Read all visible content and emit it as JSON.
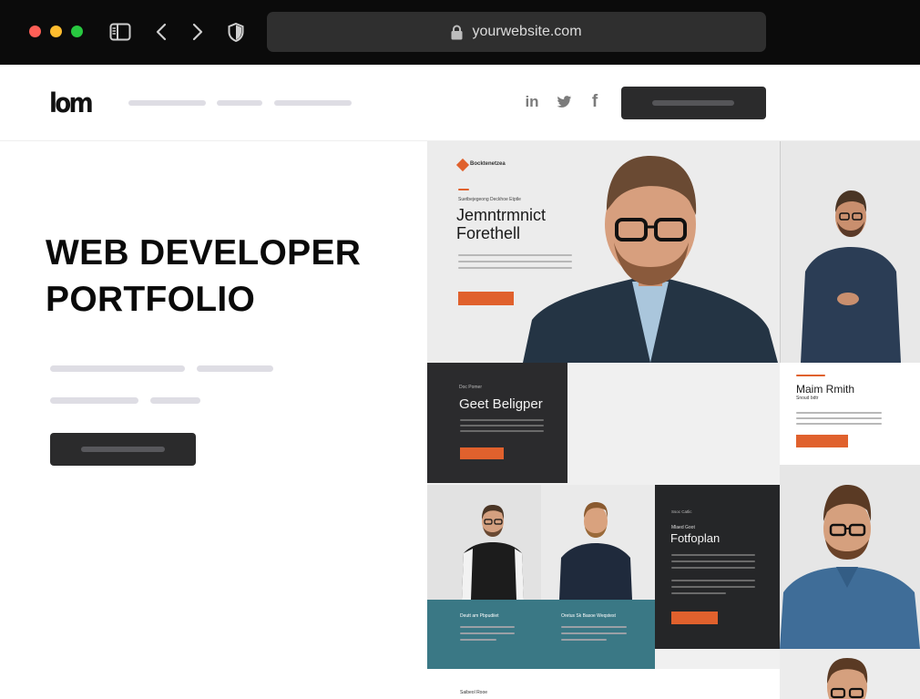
{
  "browser": {
    "url": "yourwebsite.com",
    "icons": {
      "sidebar": "sidebar-icon",
      "back": "chevron-left-icon",
      "forward": "chevron-right-icon",
      "privacy": "shield-icon",
      "lock": "lock-icon"
    }
  },
  "site": {
    "logo_text": "lom",
    "social": [
      "in",
      "twitter-icon",
      "f"
    ]
  },
  "hero": {
    "title_line1": "WEB DEVELOPER",
    "title_line2": "PORTFOLIO"
  },
  "mockup": {
    "brand": "Bocktenetzea",
    "kicker": "Suetbejegeong Deckhoe Etptle",
    "main_title_1": "Jemntrmnict",
    "main_title_2": "Forethell",
    "dark_kicker": "Doc Pomer",
    "dark_title": "Geet Beligper",
    "profile_name": "Maim Rmith",
    "profile_sub": "Snoud bdtr",
    "portfolio_kicker": "Ssoc Catlic",
    "portfolio_small": "Mlaed Goot",
    "portfolio_title": "Fotfoplan",
    "teal_left": "Deutt am Pbpudiiet",
    "teal_right": "Oretus Sk Basoe Weqstest",
    "bottom_label": "Saibeol Rooe"
  },
  "colors": {
    "chrome": "#0b0b0b",
    "accent_orange": "#e0612d",
    "dark_panel": "#2b2b2d",
    "teal": "#3a7885",
    "button_dark": "#2b2b2c"
  }
}
